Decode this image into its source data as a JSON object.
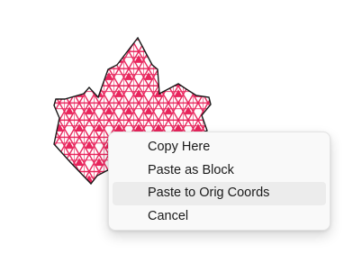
{
  "canvas": {
    "shape_icon": "maple-leaf-icon",
    "pattern": "triangle-lattice",
    "fill_color": "#e8245c",
    "background_color": "#fffdfd",
    "outline_color": "#1a1a1a"
  },
  "context_menu": {
    "hovered_item": "Paste to Orig Coords",
    "items": [
      {
        "label": "Copy Here"
      },
      {
        "label": "Paste as Block"
      },
      {
        "label": "Paste to Orig Coords"
      },
      {
        "label": "Cancel"
      }
    ]
  }
}
